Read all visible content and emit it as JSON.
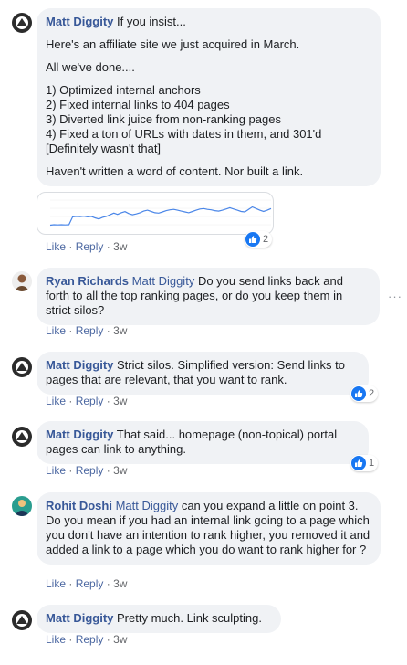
{
  "comments": [
    {
      "author": "Matt Diggity",
      "mention": "",
      "first_line": "If you insist...",
      "paragraphs": [
        "Here's an affiliate site we just acquired in March.",
        "All we've done....",
        "1) Optimized internal anchors",
        "2) Fixed internal links to 404 pages",
        "3) Diverted link juice from non-ranking pages",
        "4) Fixed a ton of URLs with dates in them, and 301'd",
        "[Definitely wasn't that]",
        "Haven't written a word of content. Nor built a link."
      ],
      "like_label": "Like",
      "reply_label": "Reply",
      "time": "3w",
      "reaction_count": "2"
    },
    {
      "author": "Ryan Richards",
      "mention": "Matt Diggity",
      "text": "Do you send links back and forth to all the top ranking pages, or do you keep them in strict silos?",
      "like_label": "Like",
      "reply_label": "Reply",
      "time": "3w"
    },
    {
      "author": "Matt Diggity",
      "text": "Strict silos. Simplified version: Send links to pages that are relevant, that you want to rank.",
      "like_label": "Like",
      "reply_label": "Reply",
      "time": "3w",
      "reaction_count": "2"
    },
    {
      "author": "Matt Diggity",
      "text": "That said... homepage (non-topical) portal pages can link to anything.",
      "like_label": "Like",
      "reply_label": "Reply",
      "time": "3w",
      "reaction_count": "1"
    },
    {
      "author": "Rohit Doshi",
      "mention": "Matt Diggity",
      "text": "can you expand a little on point 3. Do you mean if you had an internal link going to a page which you don't have an intention to rank higher, you removed it and added a link to a page which you do want to rank higher for ?",
      "like_label": "Like",
      "reply_label": "Reply",
      "time": "3w"
    },
    {
      "author": "Matt Diggity",
      "text": "Pretty much. Link sculpting.",
      "like_label": "Like",
      "reply_label": "Reply",
      "time": "3w"
    }
  ],
  "more_icon": "ellipsis-icon",
  "chart_data": {
    "type": "line",
    "ylim": [
      0,
      150
    ],
    "x": [
      0,
      1,
      2,
      3,
      4,
      5,
      6,
      7,
      8,
      9,
      10,
      11,
      12,
      13,
      14,
      15,
      16,
      17,
      18,
      19,
      20,
      21,
      22,
      23,
      24,
      25,
      26,
      27,
      28,
      29,
      30,
      31,
      32,
      33,
      34,
      35,
      36,
      37,
      38,
      39,
      40,
      41,
      42,
      43,
      44,
      45,
      46,
      47,
      48,
      49,
      50,
      51,
      52,
      53,
      54,
      55,
      56,
      57,
      58,
      59
    ],
    "values": [
      20,
      22,
      21,
      22,
      21,
      22,
      60,
      62,
      61,
      63,
      60,
      62,
      55,
      50,
      58,
      62,
      70,
      78,
      72,
      80,
      85,
      76,
      70,
      74,
      80,
      88,
      92,
      86,
      80,
      78,
      84,
      90,
      94,
      96,
      92,
      88,
      84,
      80,
      86,
      92,
      98,
      100,
      96,
      94,
      90,
      88,
      92,
      98,
      104,
      98,
      92,
      86,
      84,
      96,
      108,
      100,
      92,
      86,
      92,
      100
    ],
    "series_color": "#4a86e8"
  }
}
